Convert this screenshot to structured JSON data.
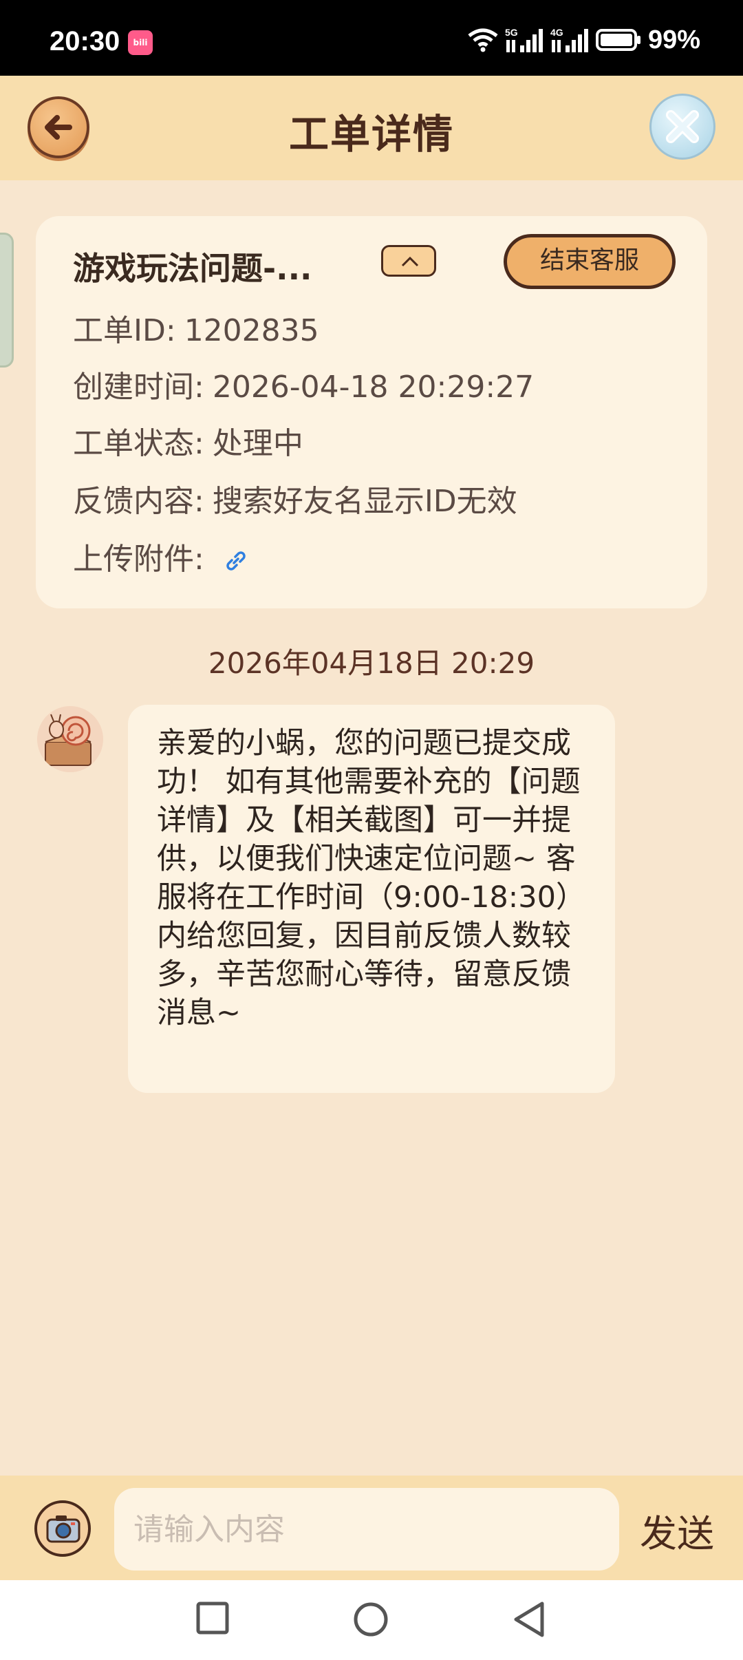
{
  "status_bar": {
    "time": "20:30",
    "app_badge": "bili",
    "battery": "99%",
    "signal_5g_label": "5G",
    "signal_4g_label": "4G"
  },
  "header": {
    "title": "工单详情",
    "back_icon": "arrow-left-icon",
    "close_icon": "close-icon"
  },
  "ticket": {
    "title": "游戏玩法问题-...",
    "end_button": "结束客服",
    "rows": [
      {
        "label": "工单ID:",
        "value": "1202835"
      },
      {
        "label": "创建时间:",
        "value": "2026-04-18 20:29:27"
      },
      {
        "label": "工单状态:",
        "value": "处理中"
      },
      {
        "label": "反馈内容:",
        "value": "搜索好友名显示ID无效"
      },
      {
        "label": "上传附件:",
        "value": ""
      }
    ]
  },
  "chat": {
    "timestamp": "2026年04月18日 20:29",
    "messages": [
      {
        "sender": "客服",
        "text": "亲爱的小蜗，您的问题已提交成功！ 如有其他需要补充的【问题详情】及【相关截图】可一并提供，以便我们快速定位问题~ 客服将在工作时间（9:00-18:30）内给您回复，因目前反馈人数较多，辛苦您耐心等待，留意反馈消息~"
      }
    ]
  },
  "input_bar": {
    "placeholder": "请输入内容",
    "value": "",
    "send_label": "发送"
  },
  "colors": {
    "page_bg": "#f8e6cf",
    "header_bg": "#f8dead",
    "card_bg": "#fdf3e2",
    "accent": "#efb06a",
    "dark_brown": "#4a2a1c",
    "link_blue": "#2f7fe0"
  }
}
